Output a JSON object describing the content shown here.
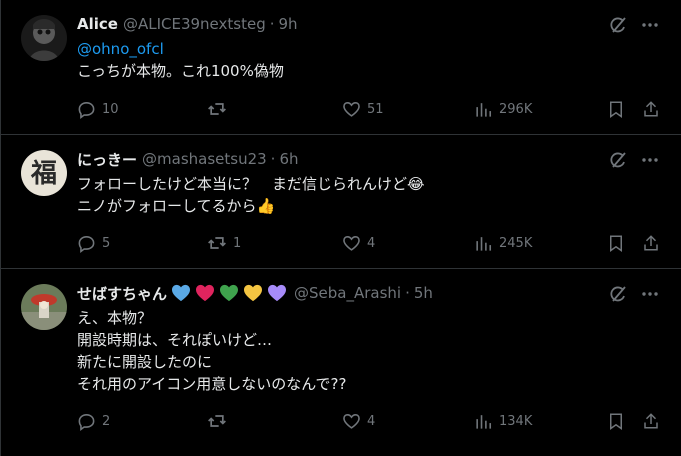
{
  "tweets": [
    {
      "name": "Alice",
      "handle": "@ALICE39nextsteg",
      "dot": "·",
      "time": "9h",
      "mention": "@ohno_ofcl",
      "lines": [
        "こっちが本物。これ100%偽物"
      ],
      "replies": "10",
      "retweets": "",
      "likes": "51",
      "views": "296K"
    },
    {
      "name": "にっきー",
      "handle": "@mashasetsu23",
      "dot": "·",
      "time": "6h",
      "lines": [
        "フォローしたけど本当に？　まだ信じられんけど😂",
        "ニノがフォローしてるから👍"
      ],
      "replies": "5",
      "retweets": "1",
      "likes": "4",
      "views": "245K"
    },
    {
      "name": "せばすちゃん",
      "name_hearts": [
        "#5aa9e6",
        "#e0245e",
        "#3fa34d",
        "#f4c542",
        "#a78bfa"
      ],
      "handle": "@Seba_Arashi",
      "dot": "·",
      "time": "5h",
      "lines": [
        "え、本物？",
        "開設時期は、それぽいけど…",
        "新たに開設したのに",
        "それ用のアイコン用意しないのなんで??"
      ],
      "replies": "2",
      "retweets": "",
      "likes": "4",
      "views": "134K"
    }
  ],
  "icons": {
    "grok": "grok-icon",
    "more": "more-icon",
    "reply": "reply-icon",
    "retweet": "retweet-icon",
    "like": "heart-icon",
    "views": "views-icon",
    "bookmark": "bookmark-icon",
    "share": "share-icon"
  },
  "colors": {
    "background": "#000000",
    "text": "#e7e9ea",
    "muted": "#71767b",
    "link": "#1d9bf0",
    "divider": "#2f3336"
  }
}
